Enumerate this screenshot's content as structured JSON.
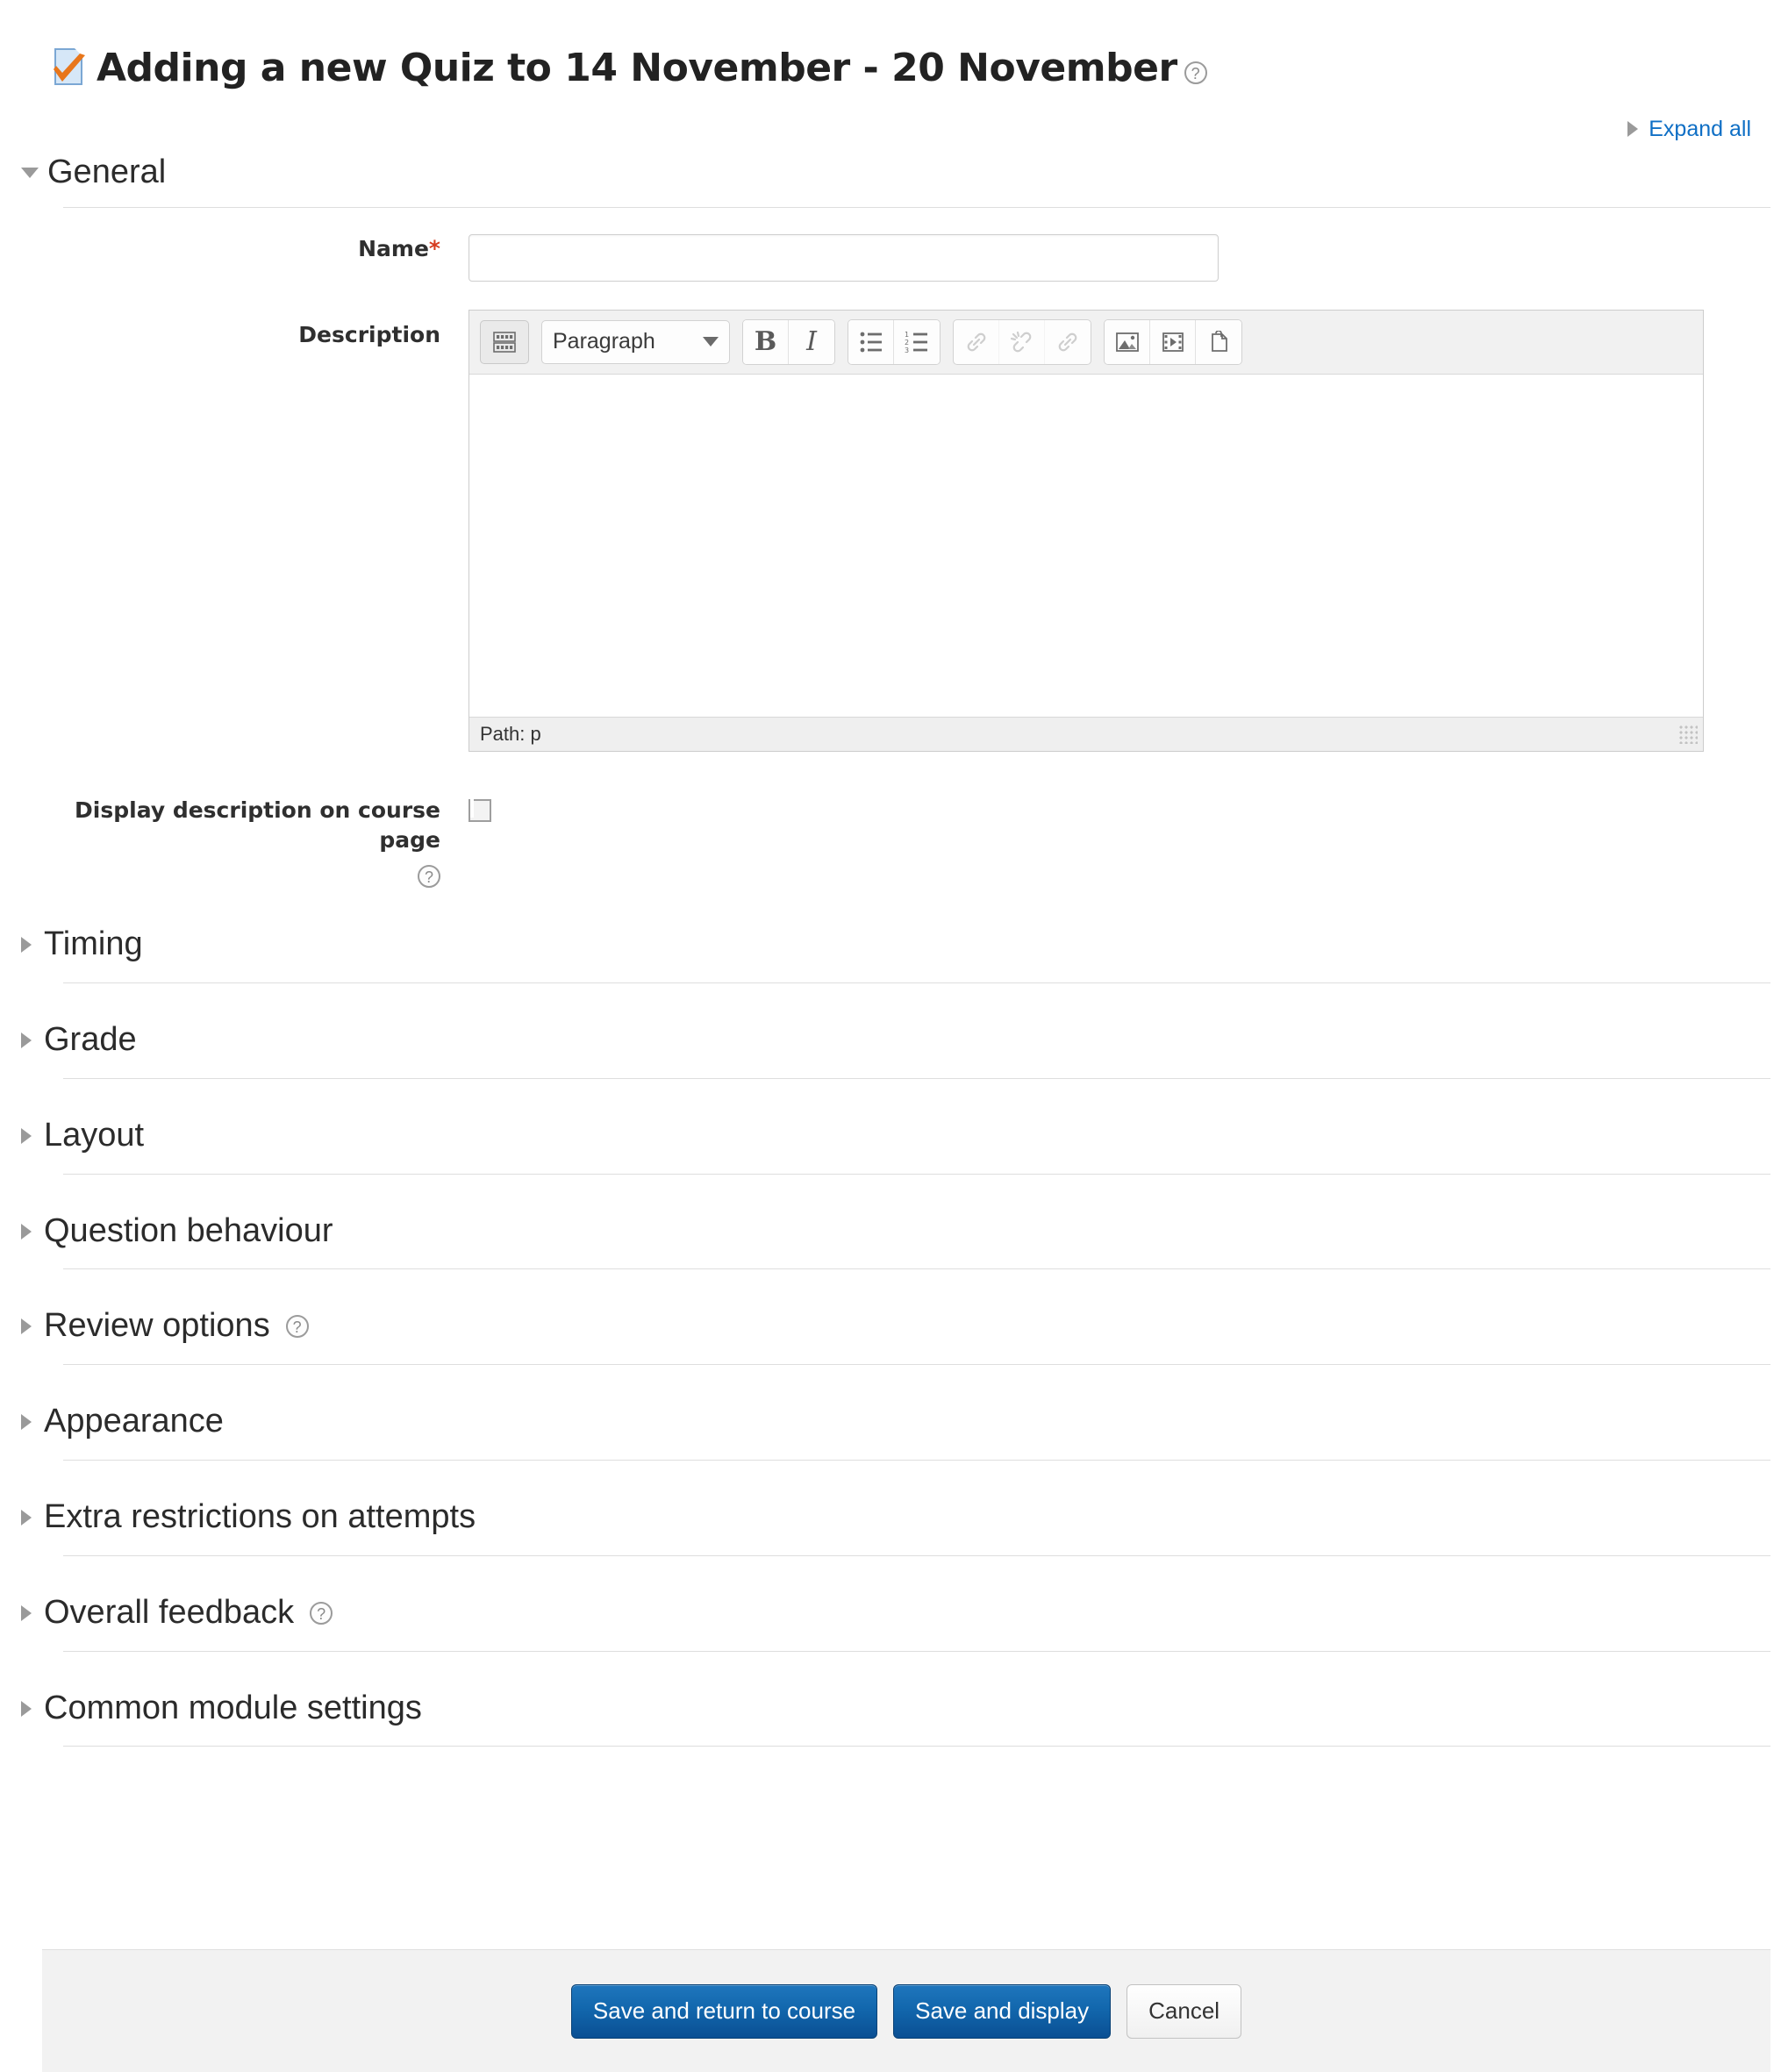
{
  "page": {
    "title": "Adding a new Quiz to 14 November - 20 November",
    "title_icon": "quiz-icon",
    "title_help_glyph": "?",
    "expand_all_label": "Expand all"
  },
  "general": {
    "heading": "General",
    "expanded": true,
    "name_label": "Name",
    "name_required_marker": "*",
    "name_value": "",
    "description_label": "Description",
    "description_value": "",
    "editor": {
      "format_select_value": "Paragraph",
      "status_path": "Path: p",
      "buttons": [
        {
          "name": "toolbar-toggle-icon",
          "title": "Show/hide advanced buttons",
          "disabled": false
        },
        {
          "name": "bold-icon",
          "glyph": "B",
          "disabled": false
        },
        {
          "name": "italic-icon",
          "glyph": "I",
          "disabled": false
        },
        {
          "name": "bullet-list-icon",
          "disabled": false
        },
        {
          "name": "numbered-list-icon",
          "disabled": false
        },
        {
          "name": "link-icon",
          "disabled": true
        },
        {
          "name": "unlink-icon",
          "disabled": true
        },
        {
          "name": "anchor-icon",
          "disabled": true
        },
        {
          "name": "image-icon",
          "disabled": false
        },
        {
          "name": "media-icon",
          "disabled": false
        },
        {
          "name": "manage-files-icon",
          "disabled": false
        }
      ]
    },
    "display_description_label_line1": "Display description on course",
    "display_description_label_line2": "page",
    "display_description_checked": false,
    "display_description_help_glyph": "?"
  },
  "sections": [
    {
      "heading": "Timing",
      "expanded": false,
      "has_help": false
    },
    {
      "heading": "Grade",
      "expanded": false,
      "has_help": false
    },
    {
      "heading": "Layout",
      "expanded": false,
      "has_help": false
    },
    {
      "heading": "Question behaviour",
      "expanded": false,
      "has_help": false
    },
    {
      "heading": "Review options",
      "expanded": false,
      "has_help": true,
      "help_glyph": "?"
    },
    {
      "heading": "Appearance",
      "expanded": false,
      "has_help": false
    },
    {
      "heading": "Extra restrictions on attempts",
      "expanded": false,
      "has_help": false
    },
    {
      "heading": "Overall feedback",
      "expanded": false,
      "has_help": true,
      "help_glyph": "?"
    },
    {
      "heading": "Common module settings",
      "expanded": false,
      "has_help": false
    }
  ],
  "footer": {
    "save_return_label": "Save and return to course",
    "save_display_label": "Save and display",
    "cancel_label": "Cancel"
  },
  "colors": {
    "link": "#0f6fc5",
    "required": "#d63c20",
    "primary_button": "#1267ad",
    "icon_gray": "#9a9a9a",
    "quiz_icon_check": "#e8761b",
    "quiz_icon_doc": "#d6e7f7"
  }
}
